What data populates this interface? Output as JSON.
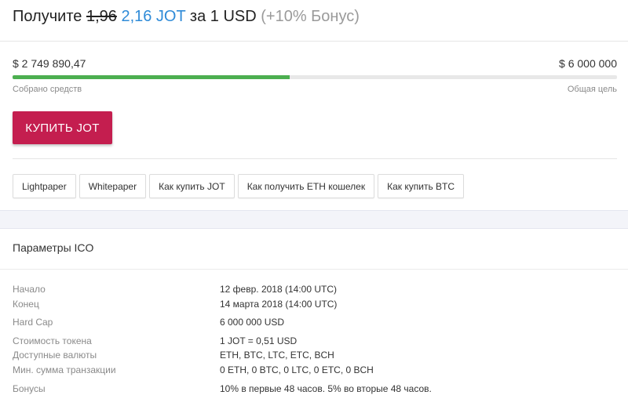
{
  "headline": {
    "prefix": "Получите",
    "old_rate": "1,96",
    "new_rate": "2,16 JOT",
    "suffix": "за 1 USD",
    "bonus": "(+10% Бонус)"
  },
  "funding": {
    "raised": "$ 2 749 890,47",
    "goal": "$ 6 000 000",
    "raised_caption": "Собрано средств",
    "goal_caption": "Общая цель",
    "progress_percent": 45.8,
    "progress_color": "#4caf50"
  },
  "buy_button": {
    "label": "КУПИТЬ JOT",
    "color": "#c41e4f"
  },
  "links": [
    {
      "label": "Lightpaper"
    },
    {
      "label": "Whitepaper"
    },
    {
      "label": "Как купить JOT"
    },
    {
      "label": "Как получить ETH кошелек"
    },
    {
      "label": "Как купить BTC"
    }
  ],
  "params": {
    "title": "Параметры ICO",
    "rows": [
      {
        "key": "Начало",
        "value": "12 февр. 2018 (14:00 UTC)"
      },
      {
        "key": "Конец",
        "value": "14 марта 2018 (14:00 UTC)"
      },
      {
        "key": "Hard Cap",
        "value": "6 000 000 USD"
      },
      {
        "key": "Стоимость токена",
        "value": "1 JOT = 0,51 USD"
      },
      {
        "key": "Доступные валюты",
        "value": "ETH,   BTC,   LTC,   ETC,   BCH"
      },
      {
        "key": "Мин. сумма транзакции",
        "value": "0 ETH,   0 BTC,   0 LTC,   0 ETC,   0 BCH"
      },
      {
        "key": "Бонусы",
        "value": "10% в первые 48 часов. 5% во вторые 48 часов."
      }
    ]
  }
}
